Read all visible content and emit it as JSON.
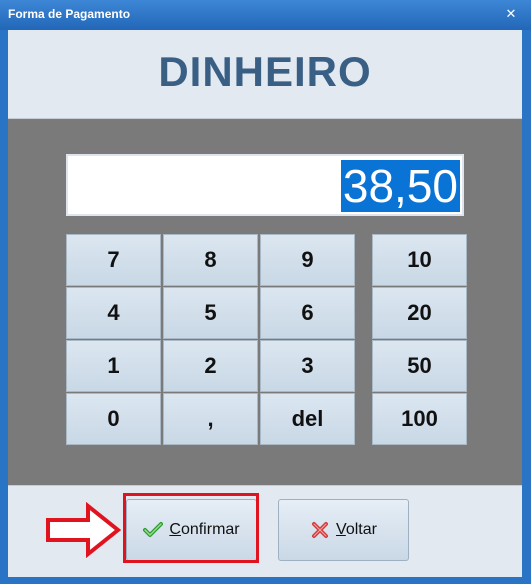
{
  "window": {
    "title": "Forma de Pagamento",
    "close_glyph": "✕"
  },
  "header": {
    "title": "DINHEIRO"
  },
  "display": {
    "value": "38,50"
  },
  "keypad": {
    "digits": [
      "7",
      "8",
      "9",
      "4",
      "5",
      "6",
      "1",
      "2",
      "3",
      "0",
      ",",
      "del"
    ],
    "amounts": [
      "10",
      "20",
      "50",
      "100"
    ]
  },
  "buttons": {
    "confirm": {
      "mnemonic": "C",
      "rest": "onfirmar",
      "icon": "check-icon"
    },
    "back": {
      "mnemonic": "V",
      "rest": "oltar",
      "icon": "cross-icon"
    }
  },
  "colors": {
    "accent": "#2a74c6",
    "header_text": "#3a5f85",
    "selection": "#0a74d6",
    "highlight": "#e0141e"
  }
}
